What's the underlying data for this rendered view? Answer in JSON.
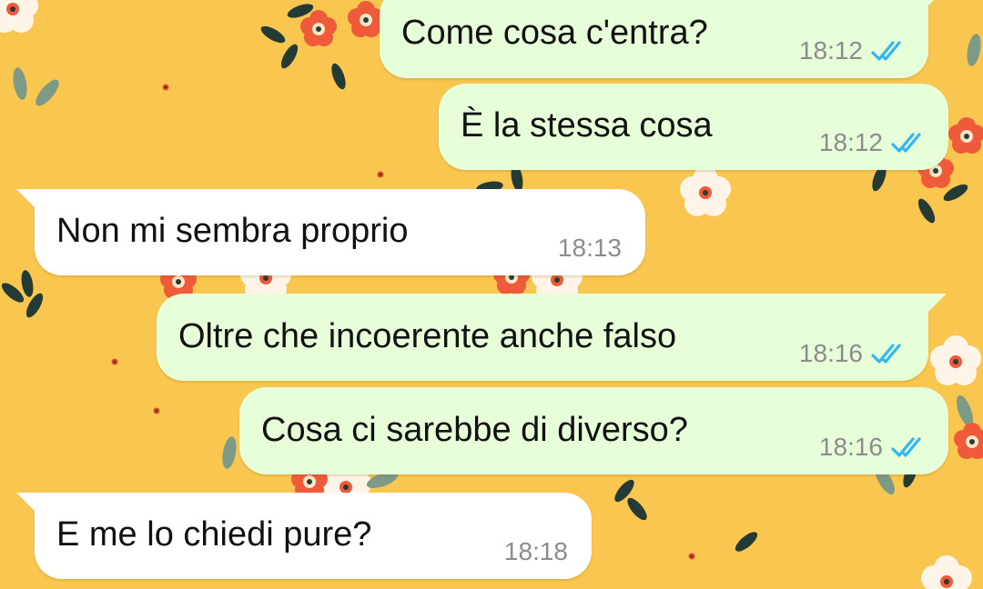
{
  "colors": {
    "wallpaper": "#f9c64f",
    "outgoing_bubble": "#e6ffd9",
    "incoming_bubble": "#ffffff",
    "read_ticks": "#34b7f1"
  },
  "messages": [
    {
      "direction": "out",
      "text": "Come cosa c'entra?",
      "time": "18:12",
      "status": "read-double-check-icon"
    },
    {
      "direction": "out",
      "text": "È la stessa cosa",
      "time": "18:12",
      "status": "read-double-check-icon"
    },
    {
      "direction": "in",
      "text": "Non mi sembra proprio",
      "time": "18:13"
    },
    {
      "direction": "out",
      "text": "Oltre che incoerente anche falso",
      "time": "18:16",
      "status": "read-double-check-icon"
    },
    {
      "direction": "out",
      "text": "Cosa ci sarebbe di diverso?",
      "time": "18:16",
      "status": "read-double-check-icon"
    },
    {
      "direction": "in",
      "text": "E me lo chiedi pure?",
      "time": "18:18"
    }
  ]
}
